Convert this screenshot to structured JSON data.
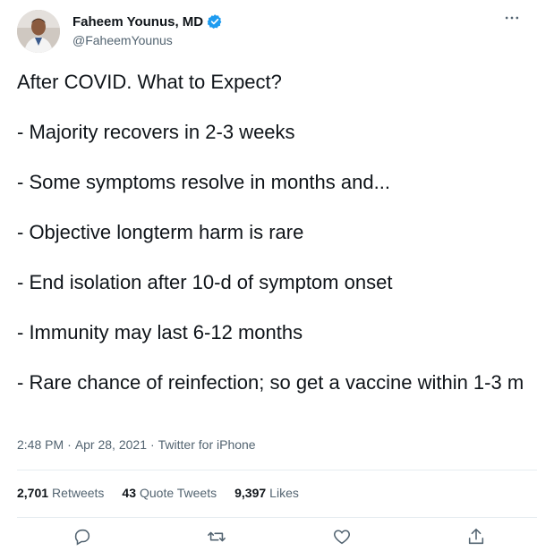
{
  "author": {
    "display_name": "Faheem Younus, MD",
    "handle": "@FaheemYounus",
    "verified": true
  },
  "tweet": {
    "lines": [
      "After COVID. What to Expect?",
      "- Majority recovers in 2-3 weeks",
      "- Some symptoms resolve in months and...",
      "- Objective longterm harm is rare",
      "- End isolation after 10-d of symptom onset",
      "- Immunity may last 6-12 months",
      "- Rare chance of reinfection; so get a vaccine within 1-3 m"
    ],
    "time": "2:48 PM",
    "date": "Apr 28, 2021",
    "source": "Twitter for iPhone"
  },
  "stats": {
    "retweets_count": "2,701",
    "retweets_label": "Retweets",
    "quotes_count": "43",
    "quotes_label": "Quote Tweets",
    "likes_count": "9,397",
    "likes_label": "Likes"
  },
  "icons": {
    "verified": "verified-badge",
    "more": "more-dots",
    "reply": "reply",
    "retweet": "retweet",
    "like": "like",
    "share": "share"
  },
  "colors": {
    "verified_blue": "#1d9bf0",
    "text_primary": "#0f1419",
    "text_secondary": "#536471",
    "divider": "#e6ecf0"
  }
}
